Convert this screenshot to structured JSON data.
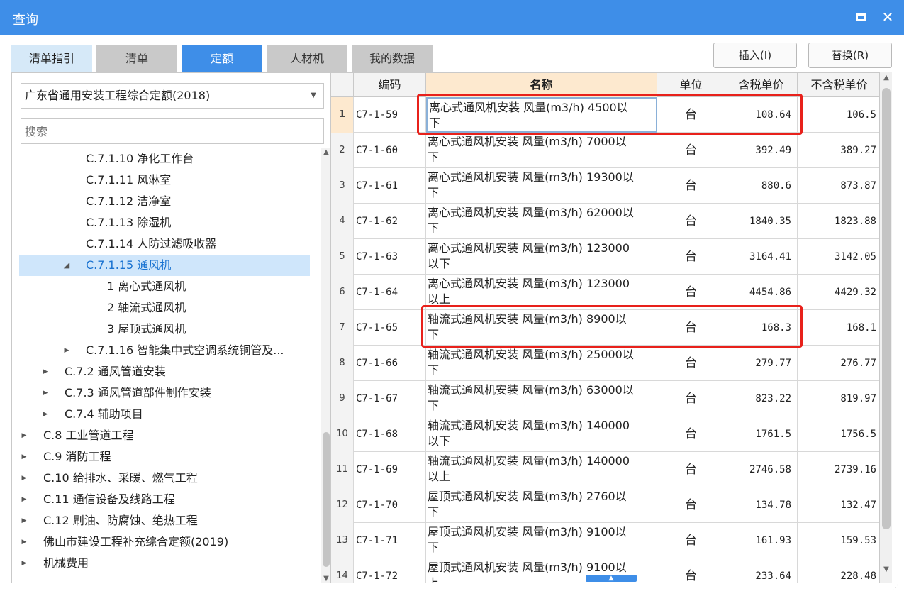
{
  "window": {
    "title": "查询"
  },
  "tabs": [
    {
      "label": "清单指引",
      "state": "light"
    },
    {
      "label": "清单",
      "state": "normal"
    },
    {
      "label": "定额",
      "state": "blue"
    },
    {
      "label": "人材机",
      "state": "normal"
    },
    {
      "label": "我的数据",
      "state": "normal"
    }
  ],
  "actions": {
    "insert": "插入(I)",
    "replace": "替换(R)"
  },
  "library": {
    "selected": "广东省通用安装工程综合定额(2018)",
    "search_placeholder": "搜索"
  },
  "tree": [
    {
      "label": "C.7.1.10 净化工作台",
      "level": 3,
      "arrow": ""
    },
    {
      "label": "C.7.1.11 风淋室",
      "level": 3,
      "arrow": ""
    },
    {
      "label": "C.7.1.12 洁净室",
      "level": 3,
      "arrow": ""
    },
    {
      "label": "C.7.1.13 除湿机",
      "level": 3,
      "arrow": ""
    },
    {
      "label": "C.7.1.14 人防过滤吸收器",
      "level": 3,
      "arrow": ""
    },
    {
      "label": "C.7.1.15 通风机",
      "level": 3,
      "arrow": "expanded",
      "selected": true
    },
    {
      "label": "1 离心式通风机",
      "level": 4,
      "arrow": ""
    },
    {
      "label": "2 轴流式通风机",
      "level": 4,
      "arrow": ""
    },
    {
      "label": "3 屋顶式通风机",
      "level": 4,
      "arrow": ""
    },
    {
      "label": "C.7.1.16 智能集中式空调系统铜管及...",
      "level": 3,
      "arrow": "collapsed"
    },
    {
      "label": "C.7.2 通风管道安装",
      "level": 2,
      "arrow": "collapsed"
    },
    {
      "label": "C.7.3 通风管道部件制作安装",
      "level": 2,
      "arrow": "collapsed"
    },
    {
      "label": "C.7.4 辅助项目",
      "level": 2,
      "arrow": "collapsed"
    },
    {
      "label": "C.8 工业管道工程",
      "level": 1,
      "arrow": "collapsed"
    },
    {
      "label": "C.9 消防工程",
      "level": 1,
      "arrow": "collapsed"
    },
    {
      "label": "C.10 给排水、采暖、燃气工程",
      "level": 1,
      "arrow": "collapsed"
    },
    {
      "label": "C.11 通信设备及线路工程",
      "level": 1,
      "arrow": "collapsed"
    },
    {
      "label": "C.12 刷油、防腐蚀、绝热工程",
      "level": 1,
      "arrow": "collapsed"
    },
    {
      "label": "佛山市建设工程补充综合定额(2019)",
      "level": 1,
      "arrow": "collapsed"
    },
    {
      "label": "机械费用",
      "level": 1,
      "arrow": "collapsed"
    }
  ],
  "grid": {
    "headers": {
      "code": "编码",
      "name": "名称",
      "unit": "单位",
      "tax": "含税单价",
      "notax": "不含税单价"
    },
    "rows": [
      {
        "idx": "1",
        "code": "C7-1-59",
        "name1": "离心式通风机安装 风量(m3/h) 4500以",
        "name2": "下",
        "unit": "台",
        "tax": "108.64",
        "notax": "106.5"
      },
      {
        "idx": "2",
        "code": "C7-1-60",
        "name1": "离心式通风机安装 风量(m3/h) 7000以",
        "name2": "下",
        "unit": "台",
        "tax": "392.49",
        "notax": "389.27"
      },
      {
        "idx": "3",
        "code": "C7-1-61",
        "name1": "离心式通风机安装 风量(m3/h) 19300以",
        "name2": "下",
        "unit": "台",
        "tax": "880.6",
        "notax": "873.87"
      },
      {
        "idx": "4",
        "code": "C7-1-62",
        "name1": "离心式通风机安装 风量(m3/h) 62000以",
        "name2": "下",
        "unit": "台",
        "tax": "1840.35",
        "notax": "1823.88"
      },
      {
        "idx": "5",
        "code": "C7-1-63",
        "name1": "离心式通风机安装 风量(m3/h) 123000",
        "name2": "以下",
        "unit": "台",
        "tax": "3164.41",
        "notax": "3142.05"
      },
      {
        "idx": "6",
        "code": "C7-1-64",
        "name1": "离心式通风机安装 风量(m3/h) 123000",
        "name2": "以上",
        "unit": "台",
        "tax": "4454.86",
        "notax": "4429.32"
      },
      {
        "idx": "7",
        "code": "C7-1-65",
        "name1": "轴流式通风机安装 风量(m3/h) 8900以",
        "name2": "下",
        "unit": "台",
        "tax": "168.3",
        "notax": "168.1"
      },
      {
        "idx": "8",
        "code": "C7-1-66",
        "name1": "轴流式通风机安装 风量(m3/h) 25000以",
        "name2": "下",
        "unit": "台",
        "tax": "279.77",
        "notax": "276.77"
      },
      {
        "idx": "9",
        "code": "C7-1-67",
        "name1": "轴流式通风机安装 风量(m3/h) 63000以",
        "name2": "下",
        "unit": "台",
        "tax": "823.22",
        "notax": "819.97"
      },
      {
        "idx": "10",
        "code": "C7-1-68",
        "name1": "轴流式通风机安装 风量(m3/h) 140000",
        "name2": "以下",
        "unit": "台",
        "tax": "1761.5",
        "notax": "1756.5"
      },
      {
        "idx": "11",
        "code": "C7-1-69",
        "name1": "轴流式通风机安装 风量(m3/h) 140000",
        "name2": "以上",
        "unit": "台",
        "tax": "2746.58",
        "notax": "2739.16"
      },
      {
        "idx": "12",
        "code": "C7-1-70",
        "name1": "屋顶式通风机安装 风量(m3/h) 2760以",
        "name2": "下",
        "unit": "台",
        "tax": "134.78",
        "notax": "132.47"
      },
      {
        "idx": "13",
        "code": "C7-1-71",
        "name1": "屋顶式通风机安装 风量(m3/h) 9100以",
        "name2": "下",
        "unit": "台",
        "tax": "161.93",
        "notax": "159.53"
      },
      {
        "idx": "14",
        "code": "C7-1-72",
        "name1": "屋顶式通风机安装 风量(m3/h) 9100以",
        "name2": "上",
        "unit": "台",
        "tax": "233.64",
        "notax": "228.48"
      }
    ]
  },
  "colors": {
    "accent": "#3e8ee8",
    "highlight": "#e8211b",
    "header_name_bg": "#fde9cf",
    "tree_selected_bg": "#cfe6fb"
  }
}
